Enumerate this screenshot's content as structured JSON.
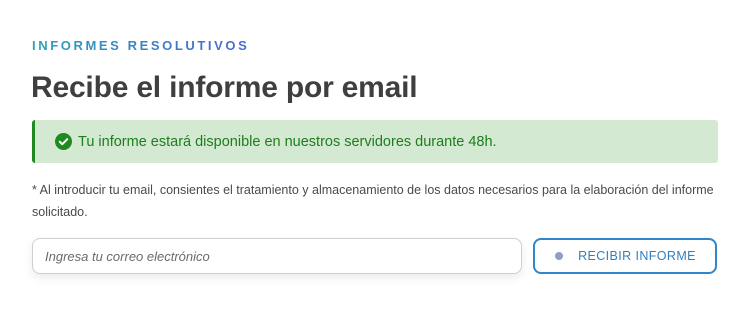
{
  "section": {
    "eyebrow": "INFORMES RESOLUTIVOS",
    "title": "Recibe el informe por email"
  },
  "alert": {
    "icon": "check-circle-icon",
    "text": "Tu informe estará disponible en nuestros servidores durante 48h.",
    "background_color": "#d3e9d1",
    "accent_color": "#1f8a1f"
  },
  "disclaimer": {
    "text": "* Al introducir tu email, consientes el tratamiento y almacenamiento de los datos necesarios para la elaboración del informe solicitado."
  },
  "form": {
    "email_placeholder": "Ingresa tu correo electrónico",
    "email_value": "",
    "submit_label": "RECIBIR INFORME",
    "submit_icon": "dot-icon",
    "accent_color": "#2f86c9"
  }
}
